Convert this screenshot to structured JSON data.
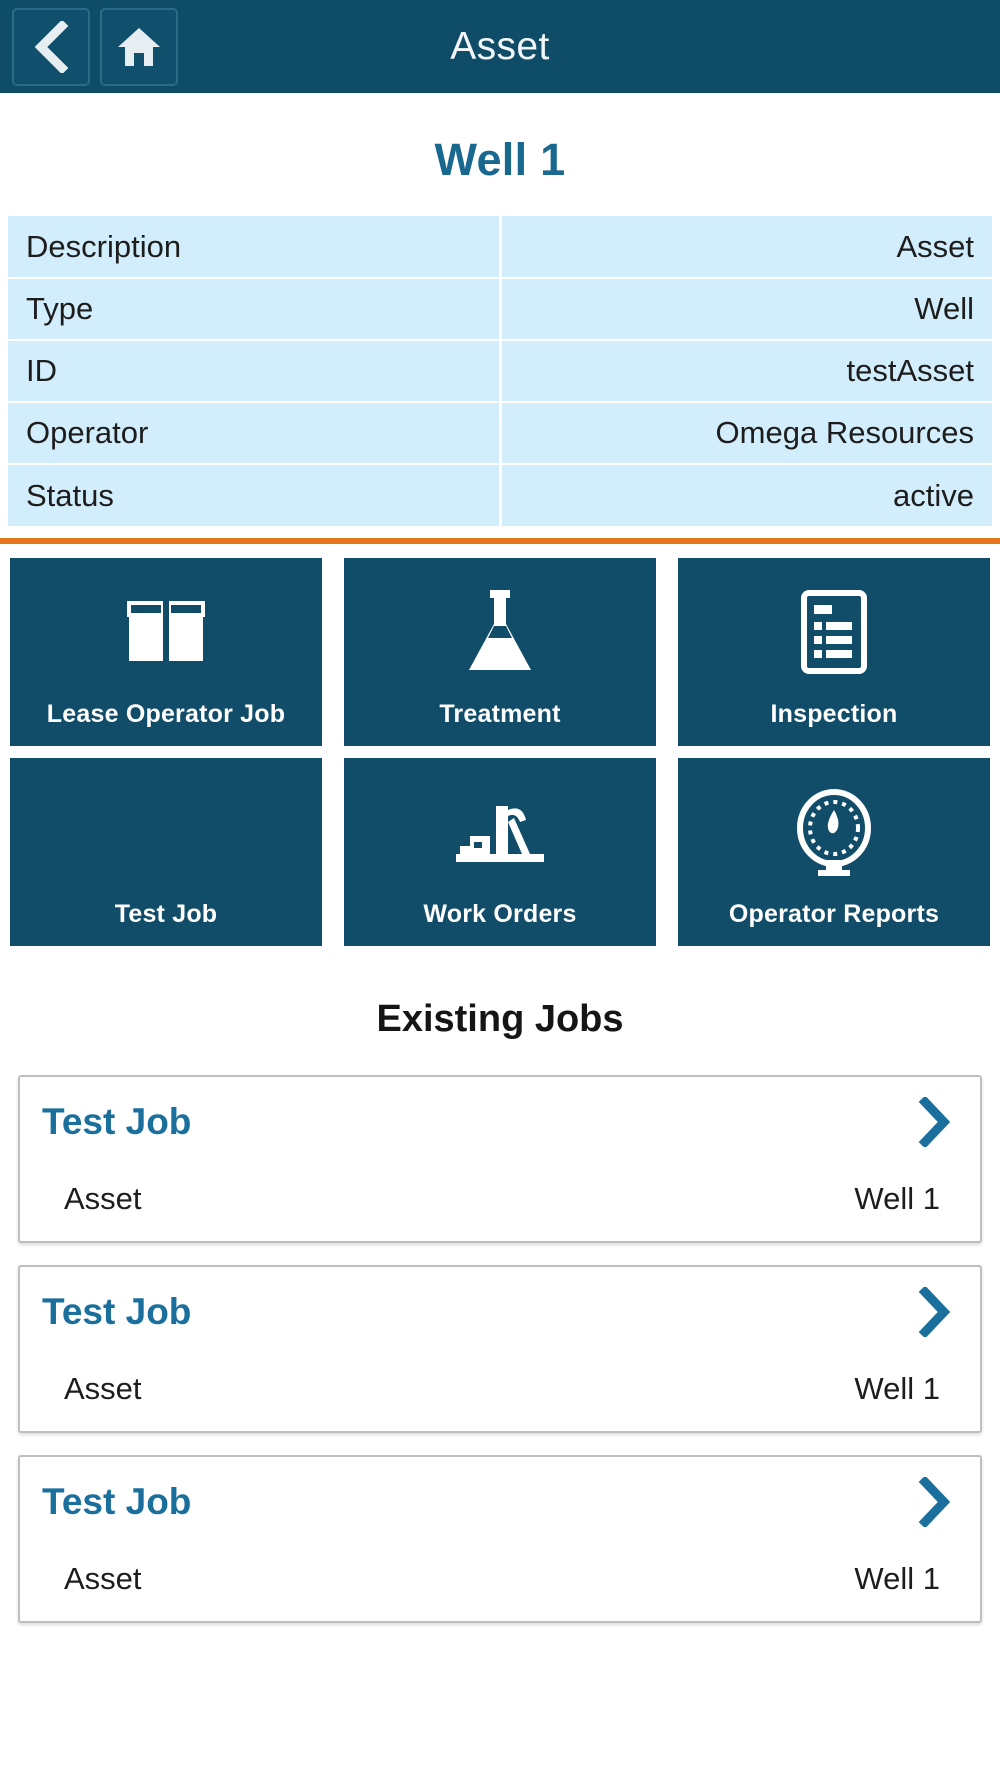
{
  "header": {
    "title": "Asset",
    "back_icon": "chevron-left-icon",
    "home_icon": "home-icon"
  },
  "asset": {
    "name": "Well 1",
    "details": [
      {
        "label": "Description",
        "value": "Asset"
      },
      {
        "label": "Type",
        "value": "Well"
      },
      {
        "label": "ID",
        "value": "testAsset"
      },
      {
        "label": "Operator",
        "value": "Omega Resources"
      },
      {
        "label": "Status",
        "value": "active"
      }
    ]
  },
  "actions": [
    {
      "label": "Lease Operator Job",
      "icon": "open-book-icon"
    },
    {
      "label": "Treatment",
      "icon": "flask-icon"
    },
    {
      "label": "Inspection",
      "icon": "clipboard-list-icon"
    },
    {
      "label": "Test Job",
      "icon": "none"
    },
    {
      "label": "Work Orders",
      "icon": "pumpjack-icon"
    },
    {
      "label": "Operator Reports",
      "icon": "gauge-icon"
    }
  ],
  "existing_jobs": {
    "heading": "Existing Jobs",
    "items": [
      {
        "title": "Test Job",
        "field_label": "Asset",
        "field_value": "Well 1",
        "chevron": "chevron-right-icon"
      },
      {
        "title": "Test Job",
        "field_label": "Asset",
        "field_value": "Well 1",
        "chevron": "chevron-right-icon"
      },
      {
        "title": "Test Job",
        "field_label": "Asset",
        "field_value": "Well 1",
        "chevron": "chevron-right-icon"
      }
    ]
  },
  "colors": {
    "header_bg": "#0e4c68",
    "tile_bg": "#114d69",
    "table_row_bg": "#d2edfb",
    "accent_orange": "#e8761c",
    "title_blue": "#19688f",
    "job_title_blue": "#1a6f9c"
  }
}
